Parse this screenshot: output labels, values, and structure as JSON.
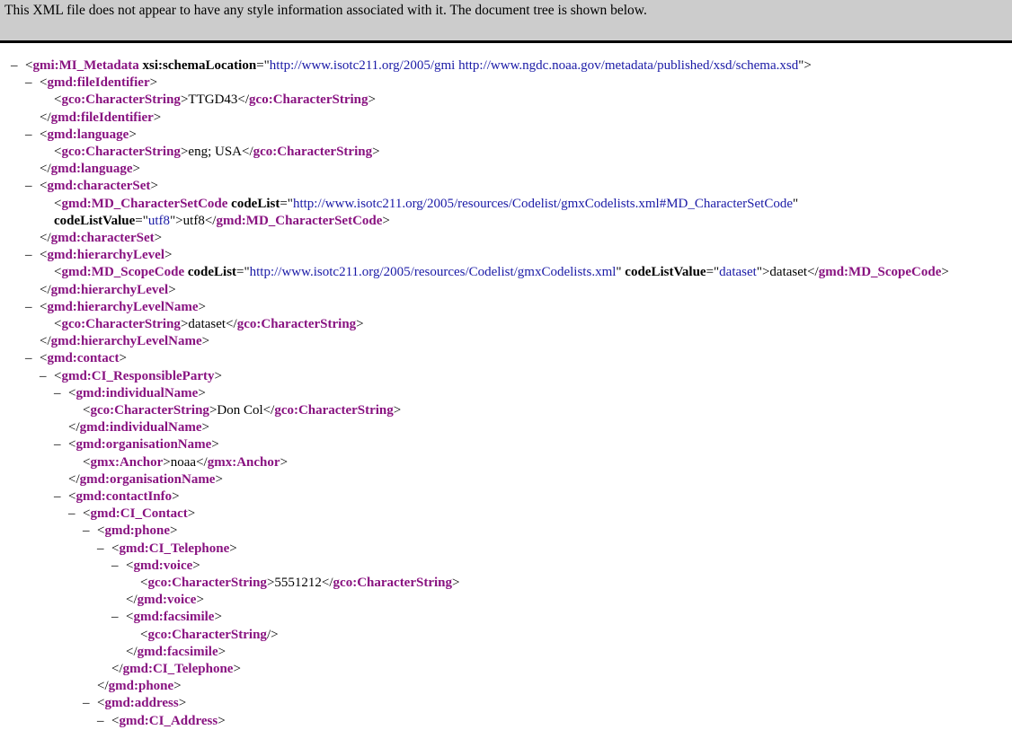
{
  "banner": {
    "message": "This XML file does not appear to have any style information associated with it. The document tree is shown below."
  },
  "lines": [
    {
      "ind": 0,
      "toggle": true,
      "parts": [
        [
          "b",
          "<"
        ],
        [
          "t",
          "gmi:MI_Metadata"
        ],
        [
          "b",
          " "
        ],
        [
          "a",
          "xsi:schemaLocation"
        ],
        [
          "b",
          "=\""
        ],
        [
          "v",
          "http://www.isotc211.org/2005/gmi http://www.ngdc.noaa.gov/metadata/published/xsd/schema.xsd"
        ],
        [
          "b",
          "\">"
        ]
      ]
    },
    {
      "ind": 1,
      "toggle": true,
      "parts": [
        [
          "b",
          "<"
        ],
        [
          "t",
          "gmd:fileIdentifier"
        ],
        [
          "b",
          ">"
        ]
      ]
    },
    {
      "ind": 2,
      "toggle": false,
      "parts": [
        [
          "b",
          "<"
        ],
        [
          "t",
          "gco:CharacterString"
        ],
        [
          "b",
          ">"
        ],
        [
          "x",
          "TTGD43"
        ],
        [
          "b",
          "</"
        ],
        [
          "t",
          "gco:CharacterString"
        ],
        [
          "b",
          ">"
        ]
      ]
    },
    {
      "ind": 1,
      "toggle": false,
      "parts": [
        [
          "b",
          "</"
        ],
        [
          "t",
          "gmd:fileIdentifier"
        ],
        [
          "b",
          ">"
        ]
      ]
    },
    {
      "ind": 1,
      "toggle": true,
      "parts": [
        [
          "b",
          "<"
        ],
        [
          "t",
          "gmd:language"
        ],
        [
          "b",
          ">"
        ]
      ]
    },
    {
      "ind": 2,
      "toggle": false,
      "parts": [
        [
          "b",
          "<"
        ],
        [
          "t",
          "gco:CharacterString"
        ],
        [
          "b",
          ">"
        ],
        [
          "x",
          "eng; USA"
        ],
        [
          "b",
          "</"
        ],
        [
          "t",
          "gco:CharacterString"
        ],
        [
          "b",
          ">"
        ]
      ]
    },
    {
      "ind": 1,
      "toggle": false,
      "parts": [
        [
          "b",
          "</"
        ],
        [
          "t",
          "gmd:language"
        ],
        [
          "b",
          ">"
        ]
      ]
    },
    {
      "ind": 1,
      "toggle": true,
      "parts": [
        [
          "b",
          "<"
        ],
        [
          "t",
          "gmd:characterSet"
        ],
        [
          "b",
          ">"
        ]
      ]
    },
    {
      "ind": 2,
      "toggle": false,
      "parts": [
        [
          "b",
          "<"
        ],
        [
          "t",
          "gmd:MD_CharacterSetCode"
        ],
        [
          "b",
          " "
        ],
        [
          "a",
          "codeList"
        ],
        [
          "b",
          "=\""
        ],
        [
          "v",
          "http://www.isotc211.org/2005/resources/Codelist/gmxCodelists.xml#MD_CharacterSetCode"
        ],
        [
          "b",
          "\""
        ]
      ]
    },
    {
      "ind": 2,
      "toggle": false,
      "parts": [
        [
          "a",
          "codeListValue"
        ],
        [
          "b",
          "=\""
        ],
        [
          "v",
          "utf8"
        ],
        [
          "b",
          "\">"
        ],
        [
          "x",
          "utf8"
        ],
        [
          "b",
          "</"
        ],
        [
          "t",
          "gmd:MD_CharacterSetCode"
        ],
        [
          "b",
          ">"
        ]
      ]
    },
    {
      "ind": 1,
      "toggle": false,
      "parts": [
        [
          "b",
          "</"
        ],
        [
          "t",
          "gmd:characterSet"
        ],
        [
          "b",
          ">"
        ]
      ]
    },
    {
      "ind": 1,
      "toggle": true,
      "parts": [
        [
          "b",
          "<"
        ],
        [
          "t",
          "gmd:hierarchyLevel"
        ],
        [
          "b",
          ">"
        ]
      ]
    },
    {
      "ind": 2,
      "toggle": false,
      "parts": [
        [
          "b",
          "<"
        ],
        [
          "t",
          "gmd:MD_ScopeCode"
        ],
        [
          "b",
          " "
        ],
        [
          "a",
          "codeList"
        ],
        [
          "b",
          "=\""
        ],
        [
          "v",
          "http://www.isotc211.org/2005/resources/Codelist/gmxCodelists.xml"
        ],
        [
          "b",
          "\" "
        ],
        [
          "a",
          "codeListValue"
        ],
        [
          "b",
          "=\""
        ],
        [
          "v",
          "dataset"
        ],
        [
          "b",
          "\">"
        ],
        [
          "x",
          "dataset"
        ],
        [
          "b",
          "</"
        ],
        [
          "t",
          "gmd:MD_ScopeCode"
        ],
        [
          "b",
          ">"
        ]
      ]
    },
    {
      "ind": 1,
      "toggle": false,
      "parts": [
        [
          "b",
          "</"
        ],
        [
          "t",
          "gmd:hierarchyLevel"
        ],
        [
          "b",
          ">"
        ]
      ]
    },
    {
      "ind": 1,
      "toggle": true,
      "parts": [
        [
          "b",
          "<"
        ],
        [
          "t",
          "gmd:hierarchyLevelName"
        ],
        [
          "b",
          ">"
        ]
      ]
    },
    {
      "ind": 2,
      "toggle": false,
      "parts": [
        [
          "b",
          "<"
        ],
        [
          "t",
          "gco:CharacterString"
        ],
        [
          "b",
          ">"
        ],
        [
          "x",
          "dataset"
        ],
        [
          "b",
          "</"
        ],
        [
          "t",
          "gco:CharacterString"
        ],
        [
          "b",
          ">"
        ]
      ]
    },
    {
      "ind": 1,
      "toggle": false,
      "parts": [
        [
          "b",
          "</"
        ],
        [
          "t",
          "gmd:hierarchyLevelName"
        ],
        [
          "b",
          ">"
        ]
      ]
    },
    {
      "ind": 1,
      "toggle": true,
      "parts": [
        [
          "b",
          "<"
        ],
        [
          "t",
          "gmd:contact"
        ],
        [
          "b",
          ">"
        ]
      ]
    },
    {
      "ind": 2,
      "toggle": true,
      "parts": [
        [
          "b",
          "<"
        ],
        [
          "t",
          "gmd:CI_ResponsibleParty"
        ],
        [
          "b",
          ">"
        ]
      ]
    },
    {
      "ind": 3,
      "toggle": true,
      "parts": [
        [
          "b",
          "<"
        ],
        [
          "t",
          "gmd:individualName"
        ],
        [
          "b",
          ">"
        ]
      ]
    },
    {
      "ind": 4,
      "toggle": false,
      "parts": [
        [
          "b",
          "<"
        ],
        [
          "t",
          "gco:CharacterString"
        ],
        [
          "b",
          ">"
        ],
        [
          "x",
          "Don Col"
        ],
        [
          "b",
          "</"
        ],
        [
          "t",
          "gco:CharacterString"
        ],
        [
          "b",
          ">"
        ]
      ]
    },
    {
      "ind": 3,
      "toggle": false,
      "parts": [
        [
          "b",
          "</"
        ],
        [
          "t",
          "gmd:individualName"
        ],
        [
          "b",
          ">"
        ]
      ]
    },
    {
      "ind": 3,
      "toggle": true,
      "parts": [
        [
          "b",
          "<"
        ],
        [
          "t",
          "gmd:organisationName"
        ],
        [
          "b",
          ">"
        ]
      ]
    },
    {
      "ind": 4,
      "toggle": false,
      "parts": [
        [
          "b",
          "<"
        ],
        [
          "t",
          "gmx:Anchor"
        ],
        [
          "b",
          ">"
        ],
        [
          "x",
          "noaa"
        ],
        [
          "b",
          "</"
        ],
        [
          "t",
          "gmx:Anchor"
        ],
        [
          "b",
          ">"
        ]
      ]
    },
    {
      "ind": 3,
      "toggle": false,
      "parts": [
        [
          "b",
          "</"
        ],
        [
          "t",
          "gmd:organisationName"
        ],
        [
          "b",
          ">"
        ]
      ]
    },
    {
      "ind": 3,
      "toggle": true,
      "parts": [
        [
          "b",
          "<"
        ],
        [
          "t",
          "gmd:contactInfo"
        ],
        [
          "b",
          ">"
        ]
      ]
    },
    {
      "ind": 4,
      "toggle": true,
      "parts": [
        [
          "b",
          "<"
        ],
        [
          "t",
          "gmd:CI_Contact"
        ],
        [
          "b",
          ">"
        ]
      ]
    },
    {
      "ind": 5,
      "toggle": true,
      "parts": [
        [
          "b",
          "<"
        ],
        [
          "t",
          "gmd:phone"
        ],
        [
          "b",
          ">"
        ]
      ]
    },
    {
      "ind": 6,
      "toggle": true,
      "parts": [
        [
          "b",
          "<"
        ],
        [
          "t",
          "gmd:CI_Telephone"
        ],
        [
          "b",
          ">"
        ]
      ]
    },
    {
      "ind": 7,
      "toggle": true,
      "parts": [
        [
          "b",
          "<"
        ],
        [
          "t",
          "gmd:voice"
        ],
        [
          "b",
          ">"
        ]
      ]
    },
    {
      "ind": 8,
      "toggle": false,
      "parts": [
        [
          "b",
          "<"
        ],
        [
          "t",
          "gco:CharacterString"
        ],
        [
          "b",
          ">"
        ],
        [
          "x",
          "5551212"
        ],
        [
          "b",
          "</"
        ],
        [
          "t",
          "gco:CharacterString"
        ],
        [
          "b",
          ">"
        ]
      ]
    },
    {
      "ind": 7,
      "toggle": false,
      "parts": [
        [
          "b",
          "</"
        ],
        [
          "t",
          "gmd:voice"
        ],
        [
          "b",
          ">"
        ]
      ]
    },
    {
      "ind": 7,
      "toggle": true,
      "parts": [
        [
          "b",
          "<"
        ],
        [
          "t",
          "gmd:facsimile"
        ],
        [
          "b",
          ">"
        ]
      ]
    },
    {
      "ind": 8,
      "toggle": false,
      "parts": [
        [
          "b",
          "<"
        ],
        [
          "t",
          "gco:CharacterString"
        ],
        [
          "b",
          "/>"
        ]
      ]
    },
    {
      "ind": 7,
      "toggle": false,
      "parts": [
        [
          "b",
          "</"
        ],
        [
          "t",
          "gmd:facsimile"
        ],
        [
          "b",
          ">"
        ]
      ]
    },
    {
      "ind": 6,
      "toggle": false,
      "parts": [
        [
          "b",
          "</"
        ],
        [
          "t",
          "gmd:CI_Telephone"
        ],
        [
          "b",
          ">"
        ]
      ]
    },
    {
      "ind": 5,
      "toggle": false,
      "parts": [
        [
          "b",
          "</"
        ],
        [
          "t",
          "gmd:phone"
        ],
        [
          "b",
          ">"
        ]
      ]
    },
    {
      "ind": 5,
      "toggle": true,
      "parts": [
        [
          "b",
          "<"
        ],
        [
          "t",
          "gmd:address"
        ],
        [
          "b",
          ">"
        ]
      ]
    },
    {
      "ind": 6,
      "toggle": true,
      "parts": [
        [
          "b",
          "<"
        ],
        [
          "t",
          "gmd:CI_Address"
        ],
        [
          "b",
          ">"
        ]
      ]
    }
  ],
  "toggle_glyph": "–",
  "colors": {
    "tag": "#881280",
    "attr_value": "#1a1aa6",
    "banner_bg": "#cccccc"
  }
}
